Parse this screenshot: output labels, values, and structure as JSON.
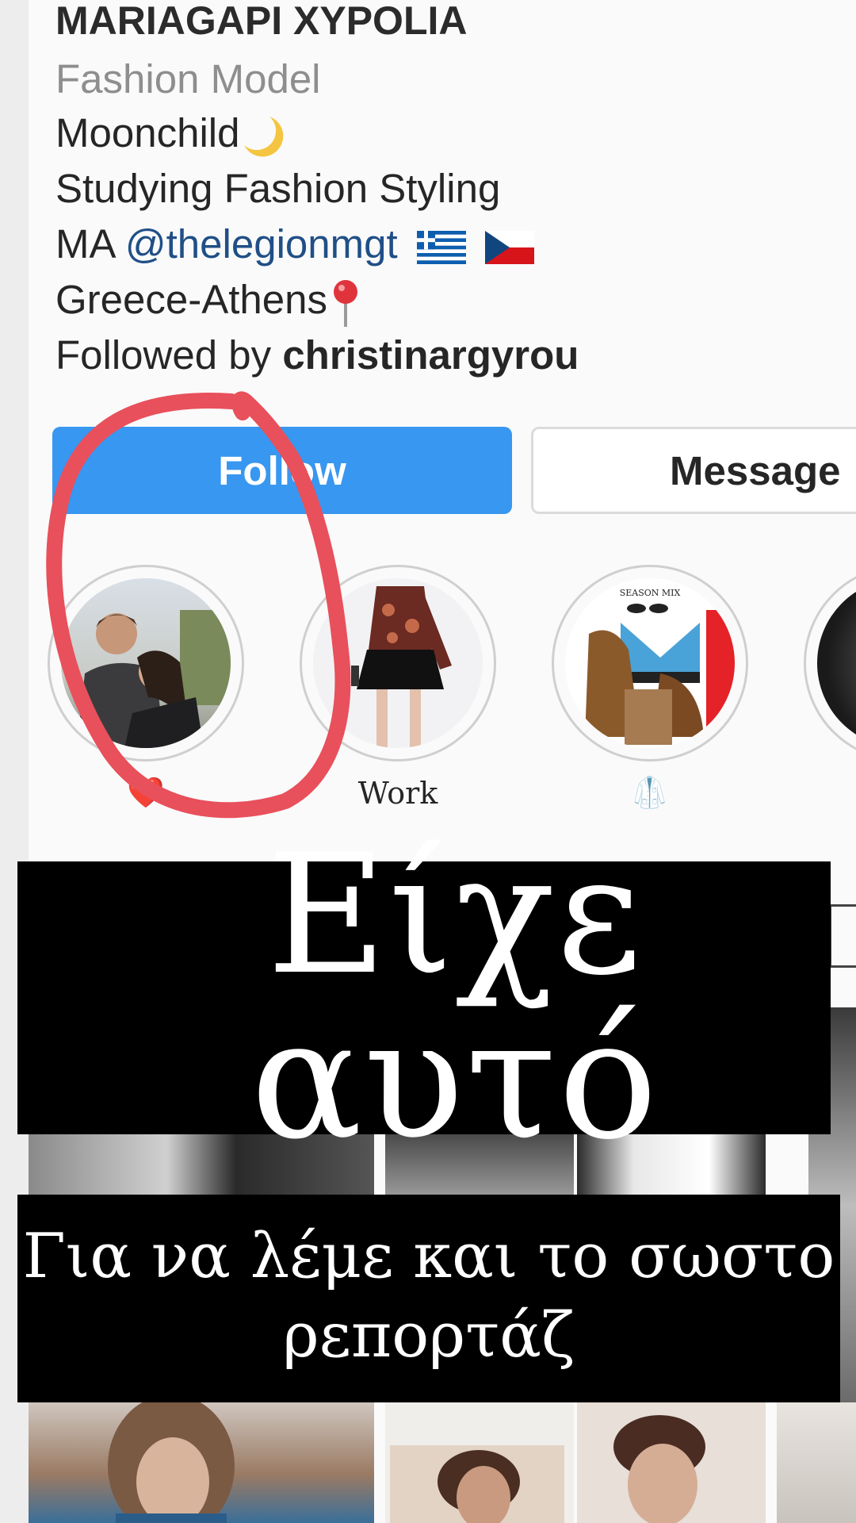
{
  "profile": {
    "name": "MARIAGAPI XYPOLIA",
    "category": "Fashion Model",
    "bio_line1": "Moonchild",
    "bio_line2": "Studying Fashion Styling",
    "bio_line3_prefix": "MA ",
    "bio_mention": "@thelegionmgt",
    "bio_line4": "Greece-Athens",
    "followed_prefix": "Followed by ",
    "followed_user": "christinargyrou"
  },
  "buttons": {
    "follow_label": "Follow",
    "message_label": "Message"
  },
  "highlights": [
    {
      "label": "❤️",
      "icon": "heart-icon"
    },
    {
      "label": "Work",
      "icon": ""
    },
    {
      "label": "🥼",
      "icon": "coat-icon"
    },
    {
      "label": "",
      "icon": ""
    }
  ],
  "highlight_text": {
    "season_mix": "SEASON MIX"
  },
  "overlays": {
    "caption1": "Είχε αυτό",
    "caption2_line1": "Για να λέμε και το σωστο",
    "caption2_line2": "ρεπορτάζ"
  },
  "colors": {
    "follow_blue": "#3897f0",
    "mention_blue": "#204f87",
    "annotation_red": "#e8505b"
  }
}
